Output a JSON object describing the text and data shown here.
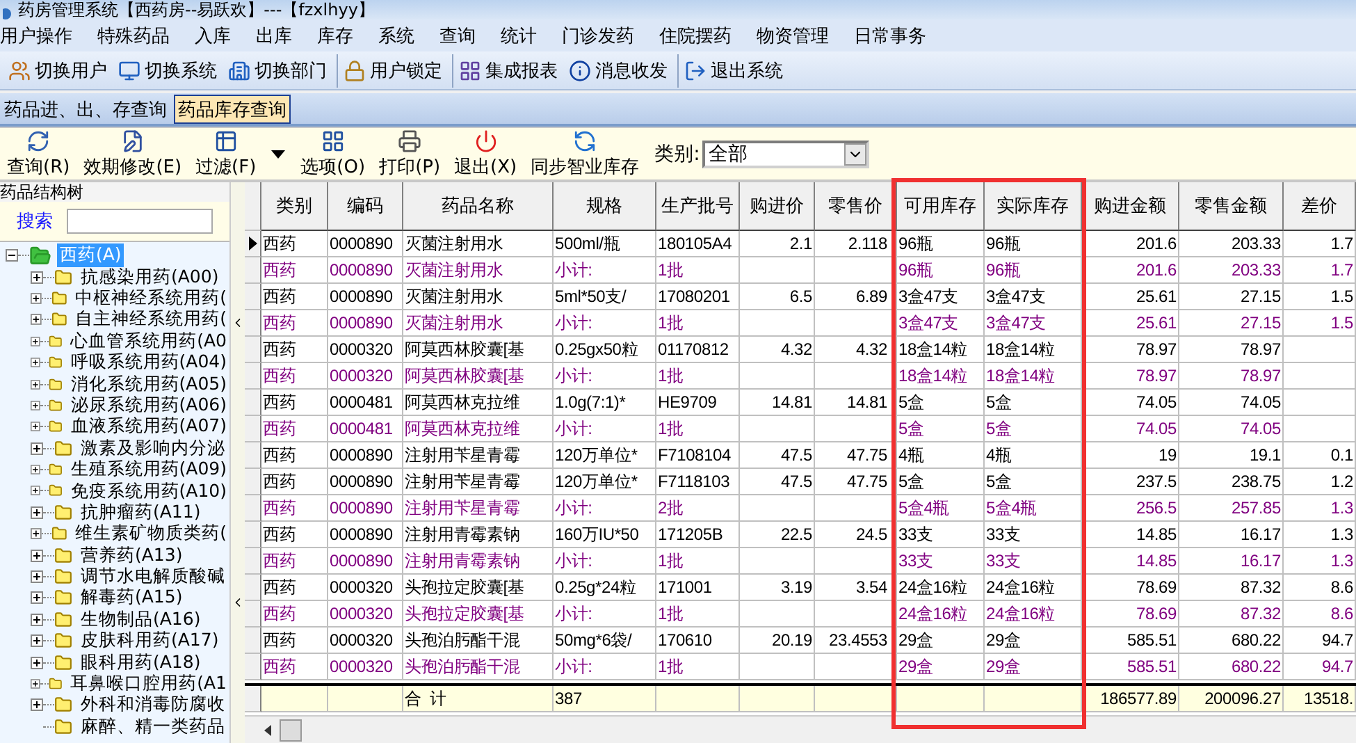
{
  "window": {
    "title": "药房管理系统【西药房--易跃欢】---【fzxlhyy】"
  },
  "menu": [
    "用户操作",
    "特殊药品",
    "入库",
    "出库",
    "库存",
    "系统",
    "查询",
    "统计",
    "门诊发药",
    "住院摆药",
    "物资管理",
    "日常事务"
  ],
  "toolbar": [
    {
      "label": "切换用户",
      "separator_before": false
    },
    {
      "label": "切换系统",
      "separator_before": false
    },
    {
      "label": "切换部门",
      "separator_before": false
    },
    {
      "label": "用户锁定",
      "separator_before": true
    },
    {
      "label": "集成报表",
      "separator_before": true
    },
    {
      "label": "消息收发",
      "separator_before": false
    },
    {
      "label": "退出系统",
      "separator_before": true
    }
  ],
  "tabs": [
    {
      "label": "药品进、出、存查询",
      "selected": false
    },
    {
      "label": "药品库存查询",
      "selected": true
    }
  ],
  "actions": [
    {
      "label": "查询(R)",
      "has_menu": false
    },
    {
      "label": "效期修改(E)",
      "has_menu": false
    },
    {
      "label": "过滤(F)",
      "has_menu": true
    },
    {
      "label": "选项(O)",
      "has_menu": false
    },
    {
      "label": "打印(P)",
      "has_menu": false
    },
    {
      "label": "退出(X)",
      "has_menu": false
    },
    {
      "label": "同步智业库存",
      "has_menu": false
    }
  ],
  "category_filter": {
    "label": "类别:",
    "value": "全部"
  },
  "tree_panel": {
    "title": "药品结构树",
    "search_label": "搜索",
    "tree": [
      {
        "label": "西药(A)",
        "selected": true,
        "expanded": true,
        "kind": "group",
        "children": [
          {
            "label": "抗感染用药(A00)",
            "selected": false,
            "expanded": false,
            "kind": "group"
          },
          {
            "label": "中枢神经系统用药(",
            "selected": false,
            "expanded": false,
            "kind": "group"
          },
          {
            "label": "自主神经系统用药(",
            "selected": false,
            "expanded": false,
            "kind": "group"
          },
          {
            "label": "心血管系统用药(A0",
            "selected": false,
            "expanded": false,
            "kind": "group"
          },
          {
            "label": "呼吸系统用药(A04)",
            "selected": false,
            "expanded": false,
            "kind": "group"
          },
          {
            "label": "消化系统用药(A05)",
            "selected": false,
            "expanded": false,
            "kind": "group"
          },
          {
            "label": "泌尿系统用药(A06)",
            "selected": false,
            "expanded": false,
            "kind": "group"
          },
          {
            "label": "血液系统用药(A07)",
            "selected": false,
            "expanded": false,
            "kind": "group"
          },
          {
            "label": "激素及影响内分泌",
            "selected": false,
            "expanded": false,
            "kind": "group"
          },
          {
            "label": "生殖系统用药(A09)",
            "selected": false,
            "expanded": false,
            "kind": "group"
          },
          {
            "label": "免疫系统用药(A10)",
            "selected": false,
            "expanded": false,
            "kind": "group"
          },
          {
            "label": "抗肿瘤药(A11)",
            "selected": false,
            "expanded": false,
            "kind": "group"
          },
          {
            "label": "维生素矿物质类药(",
            "selected": false,
            "expanded": false,
            "kind": "group"
          },
          {
            "label": "营养药(A13)",
            "selected": false,
            "expanded": false,
            "kind": "group"
          },
          {
            "label": "调节水电解质酸碱",
            "selected": false,
            "expanded": false,
            "kind": "group"
          },
          {
            "label": "解毒药(A15)",
            "selected": false,
            "expanded": false,
            "kind": "group"
          },
          {
            "label": "生物制品(A16)",
            "selected": false,
            "expanded": false,
            "kind": "group"
          },
          {
            "label": "皮肤科用药(A17)",
            "selected": false,
            "expanded": false,
            "kind": "group"
          },
          {
            "label": "眼科用药(A18)",
            "selected": false,
            "expanded": false,
            "kind": "group"
          },
          {
            "label": "耳鼻喉口腔用药(A1",
            "selected": false,
            "expanded": false,
            "kind": "group"
          },
          {
            "label": "外科和消毒防腐收",
            "selected": false,
            "expanded": false,
            "kind": "group"
          },
          {
            "label": "麻醉、精一类药品",
            "selected": false,
            "expanded": false,
            "kind": "leaf"
          }
        ]
      }
    ]
  },
  "grid": {
    "columns": [
      "类别",
      "编码",
      "药品名称",
      "规格",
      "生产批号",
      "购进价",
      "零售价",
      "可用库存",
      "实际库存",
      "购进金额",
      "零售金额",
      "差价"
    ],
    "rows": [
      {
        "kind": "item",
        "selected": true,
        "cells": {
          "category": "西药",
          "code": "0000890",
          "name": "灭菌注射用水",
          "spec": "500ml/瓶",
          "batch": "180105A4",
          "buy_price": "2.1",
          "retail_price": "2.118",
          "available": "96瓶",
          "actual": "96瓶",
          "buy_amount": "201.6",
          "retail_amount": "203.33",
          "diff": "1.7"
        }
      },
      {
        "kind": "subtotal",
        "selected": false,
        "cells": {
          "category": "西药",
          "code": "0000890",
          "name": "灭菌注射用水",
          "spec": "小计:",
          "batch": "1批",
          "available": "96瓶",
          "actual": "96瓶",
          "buy_amount": "201.6",
          "retail_amount": "203.33",
          "diff": "1.7"
        }
      },
      {
        "kind": "item",
        "selected": false,
        "cells": {
          "category": "西药",
          "code": "0000890",
          "name": "灭菌注射用水",
          "spec": "5ml*50支/",
          "batch": "17080201",
          "buy_price": "6.5",
          "retail_price": "6.89",
          "available": "3盒47支",
          "actual": "3盒47支",
          "buy_amount": "25.61",
          "retail_amount": "27.15",
          "diff": "1.5"
        }
      },
      {
        "kind": "subtotal",
        "selected": false,
        "cells": {
          "category": "西药",
          "code": "0000890",
          "name": "灭菌注射用水",
          "spec": "小计:",
          "batch": "1批",
          "available": "3盒47支",
          "actual": "3盒47支",
          "buy_amount": "25.61",
          "retail_amount": "27.15",
          "diff": "1.5"
        }
      },
      {
        "kind": "item",
        "selected": false,
        "cells": {
          "category": "西药",
          "code": "0000320",
          "name": "阿莫西林胶囊[基",
          "spec": "0.25gx50粒",
          "batch": "01170812",
          "buy_price": "4.32",
          "retail_price": "4.32",
          "available": "18盒14粒",
          "actual": "18盒14粒",
          "buy_amount": "78.97",
          "retail_amount": "78.97"
        }
      },
      {
        "kind": "subtotal",
        "selected": false,
        "cells": {
          "category": "西药",
          "code": "0000320",
          "name": "阿莫西林胶囊[基",
          "spec": "小计:",
          "batch": "1批",
          "available": "18盒14粒",
          "actual": "18盒14粒",
          "buy_amount": "78.97",
          "retail_amount": "78.97"
        }
      },
      {
        "kind": "item",
        "selected": false,
        "cells": {
          "category": "西药",
          "code": "0000481",
          "name": "阿莫西林克拉维",
          "spec": "1.0g(7:1)*",
          "batch": "HE9709",
          "buy_price": "14.81",
          "retail_price": "14.81",
          "available": "5盒",
          "actual": "5盒",
          "buy_amount": "74.05",
          "retail_amount": "74.05"
        }
      },
      {
        "kind": "subtotal",
        "selected": false,
        "cells": {
          "category": "西药",
          "code": "0000481",
          "name": "阿莫西林克拉维",
          "spec": "小计:",
          "batch": "1批",
          "available": "5盒",
          "actual": "5盒",
          "buy_amount": "74.05",
          "retail_amount": "74.05"
        }
      },
      {
        "kind": "item",
        "selected": false,
        "cells": {
          "category": "西药",
          "code": "0000890",
          "name": "注射用苄星青霉",
          "spec": "120万单位*",
          "batch": "F7108104",
          "buy_price": "47.5",
          "retail_price": "47.75",
          "available": "4瓶",
          "actual": "4瓶",
          "buy_amount": "19",
          "retail_amount": "19.1",
          "diff": "0.1"
        }
      },
      {
        "kind": "item",
        "selected": false,
        "cells": {
          "category": "西药",
          "code": "0000890",
          "name": "注射用苄星青霉",
          "spec": "120万单位*",
          "batch": "F7118103",
          "buy_price": "47.5",
          "retail_price": "47.75",
          "available": "5盒",
          "actual": "5盒",
          "buy_amount": "237.5",
          "retail_amount": "238.75",
          "diff": "1.2"
        }
      },
      {
        "kind": "subtotal",
        "selected": false,
        "cells": {
          "category": "西药",
          "code": "0000890",
          "name": "注射用苄星青霉",
          "spec": "小计:",
          "batch": "2批",
          "available": "5盒4瓶",
          "actual": "5盒4瓶",
          "buy_amount": "256.5",
          "retail_amount": "257.85",
          "diff": "1.3"
        }
      },
      {
        "kind": "item",
        "selected": false,
        "cells": {
          "category": "西药",
          "code": "0000890",
          "name": "注射用青霉素钠",
          "spec": "160万IU*50",
          "batch": "171205B",
          "buy_price": "22.5",
          "retail_price": "24.5",
          "available": "33支",
          "actual": "33支",
          "buy_amount": "14.85",
          "retail_amount": "16.17",
          "diff": "1.3"
        }
      },
      {
        "kind": "subtotal",
        "selected": false,
        "cells": {
          "category": "西药",
          "code": "0000890",
          "name": "注射用青霉素钠",
          "spec": "小计:",
          "batch": "1批",
          "available": "33支",
          "actual": "33支",
          "buy_amount": "14.85",
          "retail_amount": "16.17",
          "diff": "1.3"
        }
      },
      {
        "kind": "item",
        "selected": false,
        "cells": {
          "category": "西药",
          "code": "0000320",
          "name": "头孢拉定胶囊[基",
          "spec": "0.25g*24粒",
          "batch": "171001",
          "buy_price": "3.19",
          "retail_price": "3.54",
          "available": "24盒16粒",
          "actual": "24盒16粒",
          "buy_amount": "78.69",
          "retail_amount": "87.32",
          "diff": "8.6"
        }
      },
      {
        "kind": "subtotal",
        "selected": false,
        "cells": {
          "category": "西药",
          "code": "0000320",
          "name": "头孢拉定胶囊[基",
          "spec": "小计:",
          "batch": "1批",
          "available": "24盒16粒",
          "actual": "24盒16粒",
          "buy_amount": "78.69",
          "retail_amount": "87.32",
          "diff": "8.6"
        }
      },
      {
        "kind": "item",
        "selected": false,
        "cells": {
          "category": "西药",
          "code": "0000320",
          "name": "头孢泊肟酯干混",
          "spec": "50mg*6袋/",
          "batch": "170610",
          "buy_price": "20.19",
          "retail_price": "23.4553",
          "available": "29盒",
          "actual": "29盒",
          "buy_amount": "585.51",
          "retail_amount": "680.22",
          "diff": "94.7"
        }
      },
      {
        "kind": "subtotal",
        "selected": false,
        "cells": {
          "category": "西药",
          "code": "0000320",
          "name": "头孢泊肟酯干混",
          "spec": "小计:",
          "batch": "1批",
          "available": "29盒",
          "actual": "29盒",
          "buy_amount": "585.51",
          "retail_amount": "680.22",
          "diff": "94.7"
        }
      }
    ],
    "total": {
      "name": "合  计",
      "spec": "387",
      "buy_amount": "186577.89",
      "retail_amount": "200096.27",
      "diff": "13518."
    }
  }
}
